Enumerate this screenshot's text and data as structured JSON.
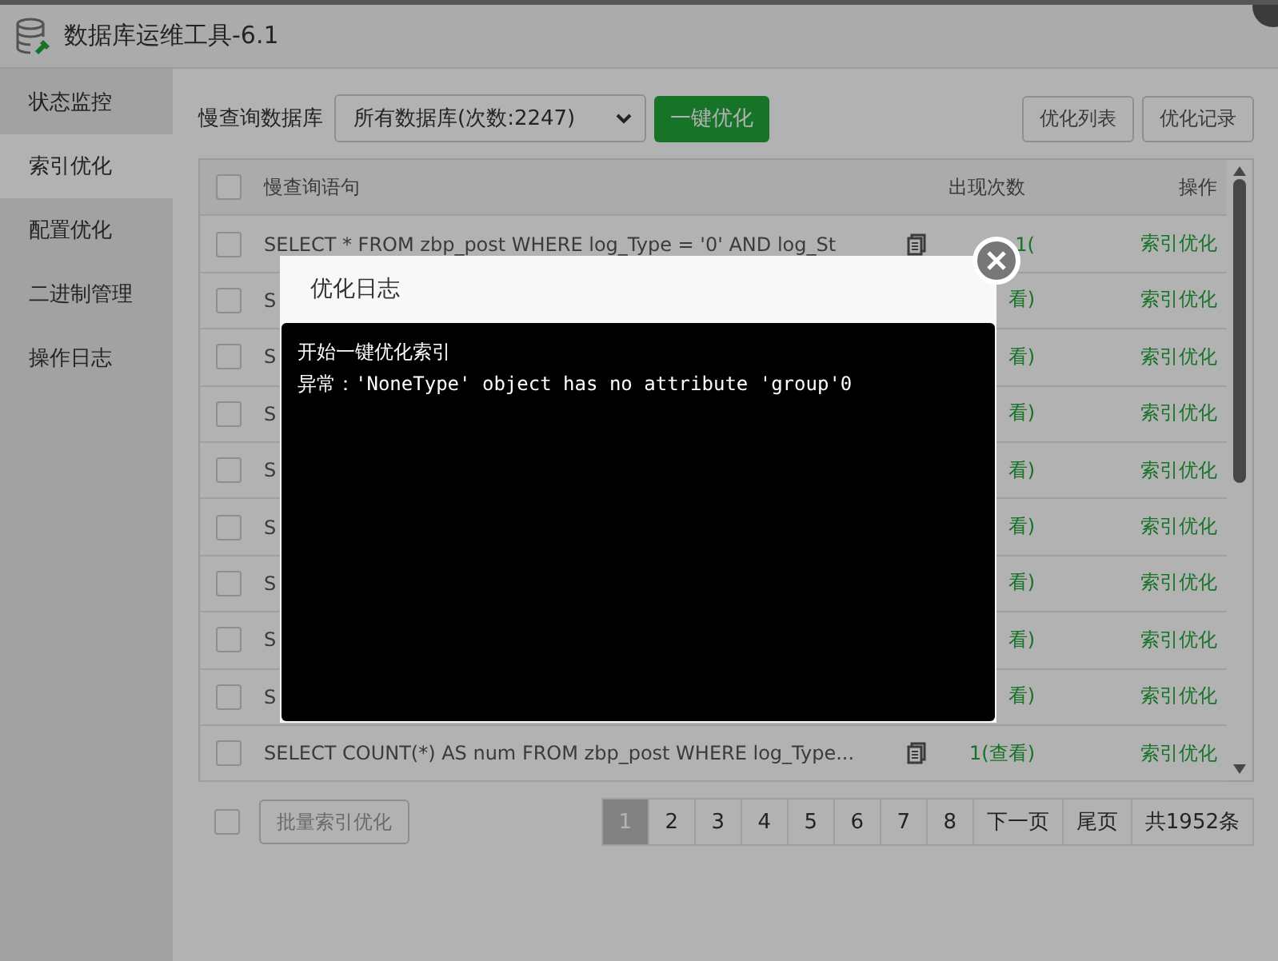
{
  "window": {
    "title": "数据库运维工具-6.1"
  },
  "sidebar": {
    "items": [
      {
        "label": "状态监控",
        "selected": false
      },
      {
        "label": "索引优化",
        "selected": true
      },
      {
        "label": "配置优化",
        "selected": false
      },
      {
        "label": "二进制管理",
        "selected": false
      },
      {
        "label": "操作日志",
        "selected": false
      }
    ]
  },
  "toolbar": {
    "db_label": "慢查询数据库",
    "db_select": "所有数据库(次数:2247)",
    "optimize_button": "一键优化",
    "buttons": [
      "优化列表",
      "优化记录"
    ]
  },
  "table": {
    "columns": [
      "慢查询语句",
      "出现次数",
      "操作"
    ],
    "header_checked": false,
    "rows": [
      {
        "checked": false,
        "query": "SELECT * FROM zbp_post WHERE log_Type = '0' AND log_St",
        "copy_icon": true,
        "count": "1(",
        "action": "索引优化"
      },
      {
        "checked": false,
        "query": "S",
        "copy_icon": false,
        "count": "看)",
        "action": "索引优化"
      },
      {
        "checked": false,
        "query": "S",
        "copy_icon": false,
        "count": "看)",
        "action": "索引优化"
      },
      {
        "checked": false,
        "query": "S",
        "copy_icon": false,
        "count": "看)",
        "action": "索引优化"
      },
      {
        "checked": false,
        "query": "S",
        "copy_icon": false,
        "count": "看)",
        "action": "索引优化"
      },
      {
        "checked": false,
        "query": "S",
        "copy_icon": false,
        "count": "看)",
        "action": "索引优化"
      },
      {
        "checked": false,
        "query": "S",
        "copy_icon": false,
        "count": "看)",
        "action": "索引优化"
      },
      {
        "checked": false,
        "query": "S",
        "copy_icon": false,
        "count": "看)",
        "action": "索引优化"
      },
      {
        "checked": false,
        "query": "S",
        "copy_icon": false,
        "count": "看)",
        "action": "索引优化"
      },
      {
        "checked": false,
        "query": "SELECT COUNT(*) AS num FROM zbp_post WHERE log_Type...",
        "copy_icon": true,
        "count": "1(查看)",
        "action": "索引优化"
      }
    ]
  },
  "footer": {
    "select_all_checked": false,
    "batch_button": "批量索引优化",
    "pages": [
      {
        "label": "1",
        "selected": true
      },
      {
        "label": "2",
        "selected": false
      },
      {
        "label": "3",
        "selected": false
      },
      {
        "label": "4",
        "selected": false
      },
      {
        "label": "5",
        "selected": false
      },
      {
        "label": "6",
        "selected": false
      },
      {
        "label": "7",
        "selected": false
      },
      {
        "label": "8",
        "selected": false
      }
    ],
    "next": "下一页",
    "last": "尾页",
    "total": "共1952条"
  },
  "dialog": {
    "title": "优化日志",
    "log": [
      "开始一键优化索引",
      "异常：'NoneType' object has no attribute 'group'0"
    ]
  }
}
